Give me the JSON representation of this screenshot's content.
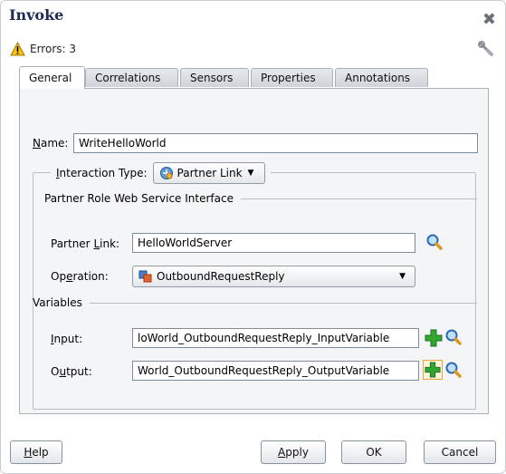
{
  "window": {
    "title": "Invoke"
  },
  "status": {
    "errors_text": "Errors: 3"
  },
  "tabs": [
    {
      "label": "General",
      "active": true
    },
    {
      "label": "Correlations",
      "active": false
    },
    {
      "label": "Sensors",
      "active": false
    },
    {
      "label": "Properties",
      "active": false
    },
    {
      "label": "Annotations",
      "active": false
    }
  ],
  "general": {
    "name_label": "Name:",
    "name_value": "WriteHelloWorld",
    "interaction_label": "Interaction Type:",
    "interaction_value": "Partner Link",
    "section_title": "Partner Role Web Service Interface",
    "partner_link_label": "Partner Link:",
    "partner_link_value": "HelloWorldServer",
    "operation_label": "Operation:",
    "operation_value": "OutboundRequestReply",
    "variables_title": "Variables",
    "input_label": "Input:",
    "input_value": "loWorld_OutboundRequestReply_InputVariable",
    "output_label": "Output:",
    "output_value": "World_OutboundRequestReply_OutputVariable"
  },
  "buttons": {
    "help": "Help",
    "apply": "Apply",
    "ok": "OK",
    "cancel": "Cancel"
  },
  "colors": {
    "title": "#1c2a55",
    "panel": "#f4f5f7",
    "tab_border": "#a9b0b8",
    "plus_green": "#33a532",
    "warning_yellow": "#f4c313"
  },
  "icons": {
    "close": "close-icon",
    "warning": "warning-icon",
    "wrench": "wrench-icon",
    "search": "magnifier-icon",
    "add": "plus-icon",
    "partner_link": "partner-link-icon",
    "operation": "operation-icon"
  }
}
